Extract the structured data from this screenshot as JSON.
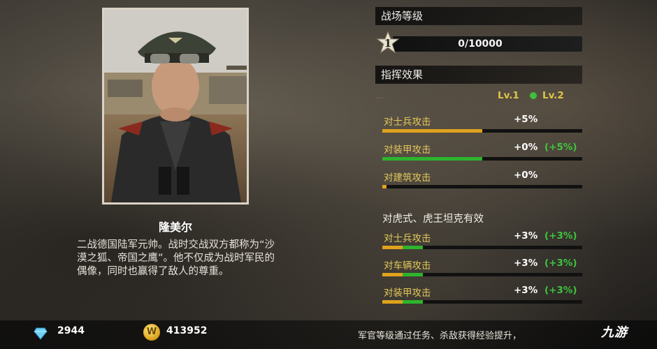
{
  "general": {
    "name": "隆美尔",
    "bio": "二战德国陆军元帅。战时交战双方都称为“沙漠之狐、帝国之鹰”。他不仅成为战时军民的偶像，同时也赢得了敌人的尊重。"
  },
  "battlefield": {
    "header": "战场等级",
    "rank": "1",
    "exp_text": "0/10000",
    "exp_progress": 0
  },
  "command": {
    "header": "指挥效果",
    "faded_text": "…",
    "lv1_label": "Lv.1",
    "lv2_label": "Lv.2",
    "effects": [
      {
        "label": "对士兵攻击",
        "value": "+5%",
        "extra": "",
        "lv1_fill": 0.5,
        "lv2_fill": 0
      },
      {
        "label": "对装甲攻击",
        "value": "+0%",
        "extra": "(+5%)",
        "lv1_fill": 0,
        "lv2_fill": 0.5
      },
      {
        "label": "对建筑攻击",
        "value": "+0%",
        "extra": "",
        "lv1_fill": 0.02,
        "lv2_fill": 0
      }
    ]
  },
  "tiger": {
    "header": "对虎式、虎王坦克有效",
    "effects": [
      {
        "label": "对士兵攻击",
        "value": "+3%",
        "extra": "(+3%)",
        "lv1_fill": 0.1,
        "lv2_fill": 0.1
      },
      {
        "label": "对车辆攻击",
        "value": "+3%",
        "extra": "(+3%)",
        "lv1_fill": 0.1,
        "lv2_fill": 0.1
      },
      {
        "label": "对装甲攻击",
        "value": "+3%",
        "extra": "(+3%)",
        "lv1_fill": 0.1,
        "lv2_fill": 0.1
      }
    ]
  },
  "currency": {
    "gems": "2944",
    "coin_symbol": "W",
    "coins": "413952"
  },
  "footer": {
    "tip": "军官等级通过任务、杀敌获得经验提升，",
    "logo": "九游"
  },
  "colors": {
    "lv1_fill": "#e0a21d",
    "lv2_fill": "#2db52d",
    "label_gold": "#e2c85a",
    "extra_green": "#3ec43e"
  }
}
